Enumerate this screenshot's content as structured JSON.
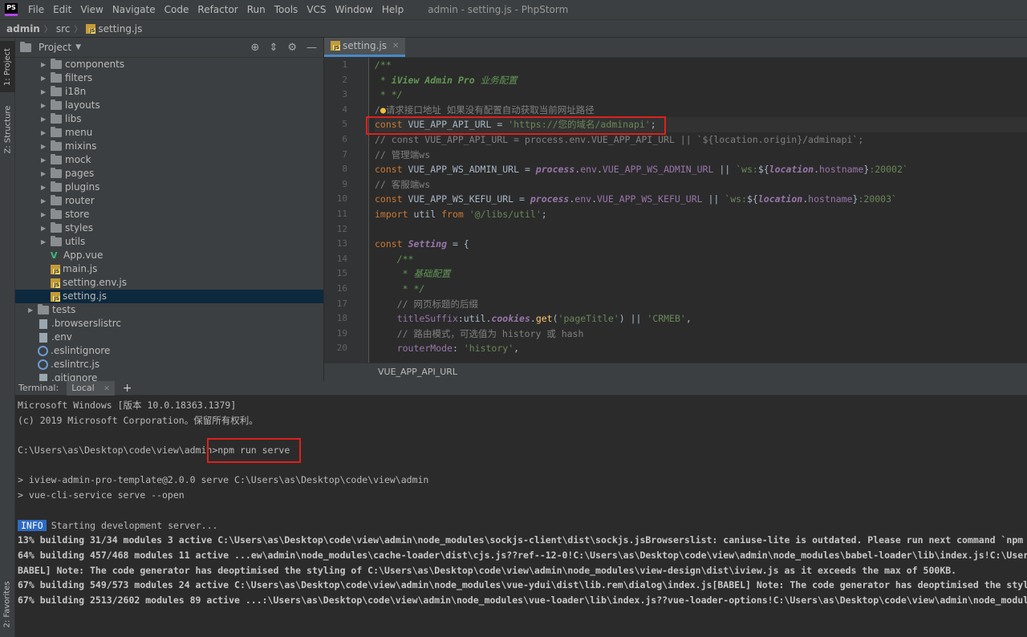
{
  "menubar": {
    "logo": "PS",
    "items": [
      "File",
      "Edit",
      "View",
      "Navigate",
      "Code",
      "Refactor",
      "Run",
      "Tools",
      "VCS",
      "Window",
      "Help"
    ],
    "window_title": "admin - setting.js - PhpStorm"
  },
  "breadcrumb": {
    "project": "admin",
    "folder": "src",
    "file": "setting.js"
  },
  "left_strip": {
    "project": "1: Project",
    "structure": "Z: Structure",
    "favorites": "2: Favorites"
  },
  "project_panel": {
    "title": "Project",
    "tree": [
      {
        "label": "components",
        "type": "folder",
        "indent": 1
      },
      {
        "label": "filters",
        "type": "folder",
        "indent": 1
      },
      {
        "label": "i18n",
        "type": "folder",
        "indent": 1
      },
      {
        "label": "layouts",
        "type": "folder",
        "indent": 1
      },
      {
        "label": "libs",
        "type": "folder",
        "indent": 1
      },
      {
        "label": "menu",
        "type": "folder",
        "indent": 1
      },
      {
        "label": "mixins",
        "type": "folder",
        "indent": 1
      },
      {
        "label": "mock",
        "type": "folder",
        "indent": 1
      },
      {
        "label": "pages",
        "type": "folder",
        "indent": 1
      },
      {
        "label": "plugins",
        "type": "folder",
        "indent": 1
      },
      {
        "label": "router",
        "type": "folder",
        "indent": 1
      },
      {
        "label": "store",
        "type": "folder",
        "indent": 1
      },
      {
        "label": "styles",
        "type": "folder",
        "indent": 1
      },
      {
        "label": "utils",
        "type": "folder",
        "indent": 1
      },
      {
        "label": "App.vue",
        "type": "vue",
        "indent": 1
      },
      {
        "label": "main.js",
        "type": "js",
        "indent": 1
      },
      {
        "label": "setting.env.js",
        "type": "js",
        "indent": 1
      },
      {
        "label": "setting.js",
        "type": "js",
        "indent": 1,
        "selected": true
      },
      {
        "label": "tests",
        "type": "folder",
        "indent": 0
      },
      {
        "label": ".browserslistrc",
        "type": "file",
        "indent": 0
      },
      {
        "label": ".env",
        "type": "file",
        "indent": 0
      },
      {
        "label": ".eslintignore",
        "type": "dot",
        "indent": 0
      },
      {
        "label": ".eslintrc.js",
        "type": "dot",
        "indent": 0
      },
      {
        "label": ".gitignore",
        "type": "file",
        "indent": 0
      }
    ]
  },
  "editor": {
    "tab": "setting.js",
    "breadcrumb": "VUE_APP_API_URL",
    "line_numbers": [
      "1",
      "2",
      "3",
      "4",
      "5",
      "6",
      "7",
      "8",
      "9",
      "10",
      "11",
      "12",
      "13",
      "14",
      "15",
      "16",
      "17",
      "18",
      "19",
      "20"
    ]
  },
  "terminal": {
    "label": "Terminal:",
    "tab": "Local",
    "lines": [
      "Microsoft Windows [版本 10.0.18363.1379]",
      "(c) 2019 Microsoft Corporation。保留所有权利。",
      "",
      "C:\\Users\\as\\Desktop\\code\\view\\admin>npm run serve",
      "",
      "> iview-admin-pro-template@2.0.0 serve C:\\Users\\as\\Desktop\\code\\view\\admin",
      "> vue-cli-service serve --open",
      ""
    ],
    "info_badge": "INFO",
    "info_text": "Starting development server...",
    "build_lines": [
      "13% building 31/34 modules 3 active C:\\Users\\as\\Desktop\\code\\view\\admin\\node_modules\\sockjs-client\\dist\\sockjs.jsBrowserslist: caniuse-lite is outdated. Please run next command `npm upda",
      "64% building 457/468 modules 11 active ...ew\\admin\\node_modules\\cache-loader\\dist\\cjs.js??ref--12-0!C:\\Users\\as\\Desktop\\code\\view\\admin\\node_modules\\babel-loader\\lib\\index.js!C:\\Users\\as",
      "BABEL] Note: The code generator has deoptimised the styling of C:\\Users\\as\\Desktop\\code\\view\\admin\\node_modules\\view-design\\dist\\iview.js as it exceeds the max of 500KB.",
      "67% building 549/573 modules 24 active C:\\Users\\as\\Desktop\\code\\view\\admin\\node_modules\\vue-ydui\\dist\\lib.rem\\dialog\\index.js[BABEL] Note: The code generator has deoptimised the styling",
      "67% building 2513/2602 modules 89 active ...:\\Users\\as\\Desktop\\code\\view\\admin\\node_modules\\vue-loader\\lib\\index.js??vue-loader-options!C:\\Users\\as\\Desktop\\code\\view\\admin\\node_modules\\i"
    ]
  },
  "colors": {
    "highlight": "#e0201c",
    "selection": "#0d293e",
    "accent": "#4a88c7"
  }
}
